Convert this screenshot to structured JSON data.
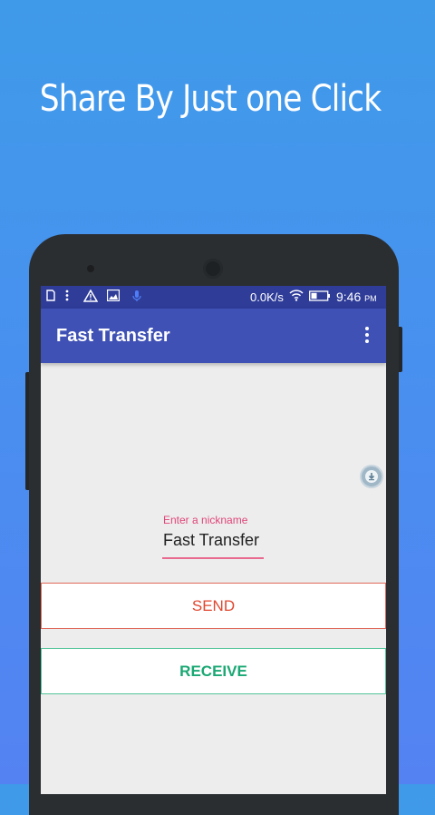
{
  "promo": {
    "headline": "Share By  Just one Click"
  },
  "status_bar": {
    "network_speed": "0.0K/s",
    "time": "9:46",
    "am_pm": "PM",
    "icons": [
      "sim-icon",
      "more-dots-icon",
      "warning-icon",
      "image-icon",
      "mic-icon",
      "wifi-icon",
      "battery-icon"
    ]
  },
  "app_bar": {
    "title": "Fast Transfer",
    "menu_icon": "overflow-menu-icon"
  },
  "nickname": {
    "label": "Enter a nickname",
    "value": "Fast Transfer"
  },
  "buttons": {
    "send": "SEND",
    "receive": "RECEIVE"
  },
  "floating": {
    "icon": "download-icon"
  },
  "colors": {
    "background": "#4a8ef0",
    "status_bar": "#2f3d99",
    "app_bar": "#3f51b5",
    "send_text": "#e0472f",
    "receive_text": "#1aa874",
    "nickname_label": "#e0457a"
  }
}
